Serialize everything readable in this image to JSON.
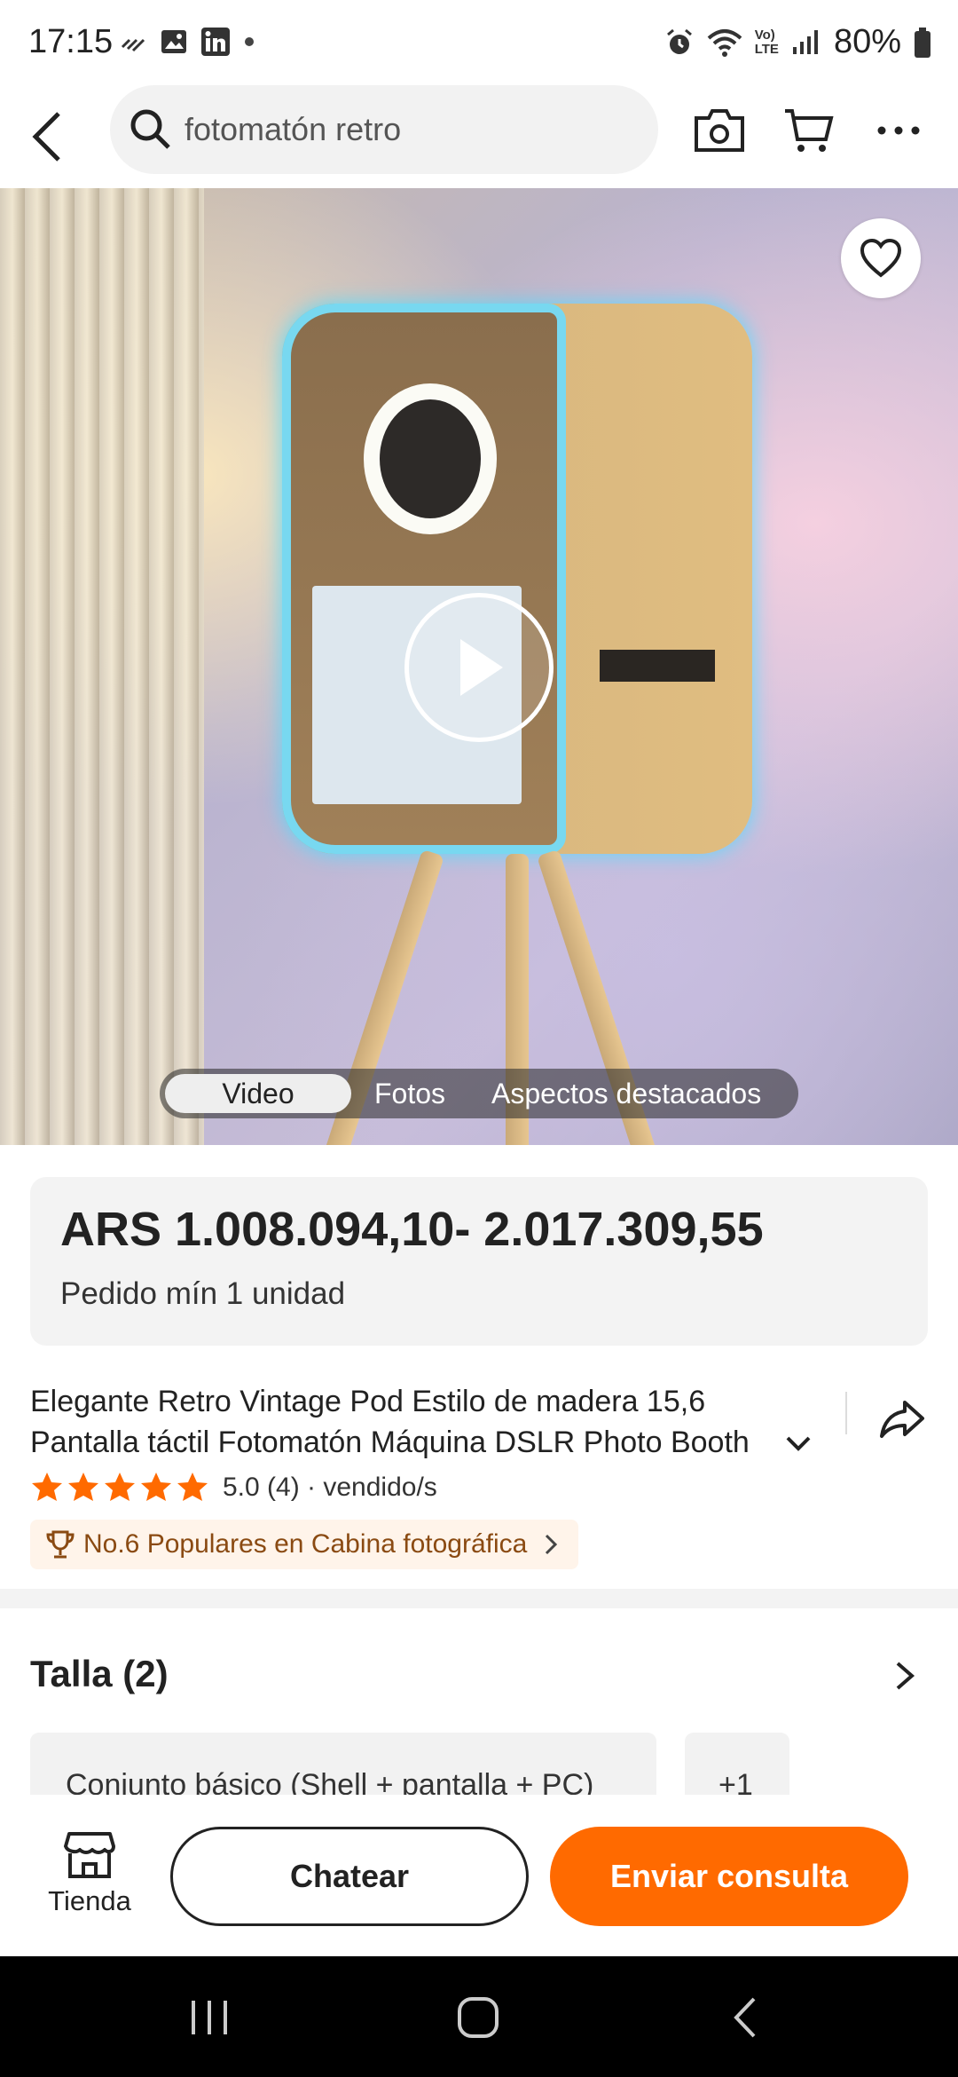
{
  "status_bar": {
    "time": "17:15",
    "battery": "80%",
    "volte_line1": "Vo)",
    "volte_line2": "LTE"
  },
  "header": {
    "search_text": "fotomatón retro"
  },
  "media": {
    "tabs": [
      "Video",
      "Fotos",
      "Aspectos destacados"
    ],
    "active_tab": "Video"
  },
  "price": {
    "range": "ARS 1.008.094,10- 2.017.309,55",
    "min_order": "Pedido mín 1 unidad"
  },
  "product": {
    "title": "Elegante Retro Vintage Pod Estilo de madera 15,6 Pantalla táctil Fotomatón Máquina DSLR Photo Booth",
    "rating_text": "5.0 (4) · vendido/s",
    "rating_stars": 5,
    "rank_text": "No.6 Populares en Cabina fotográfica"
  },
  "size": {
    "title": "Talla (2)",
    "option": "Conjunto básico (Shell + pantalla + PC)",
    "more": "+1"
  },
  "actions": {
    "store_label": "Tienda",
    "chat_label": "Chatear",
    "inquiry_label": "Enviar consulta"
  },
  "colors": {
    "accent": "#ff6a00",
    "rank_text": "#8a4a12",
    "star": "#ff6a00"
  }
}
